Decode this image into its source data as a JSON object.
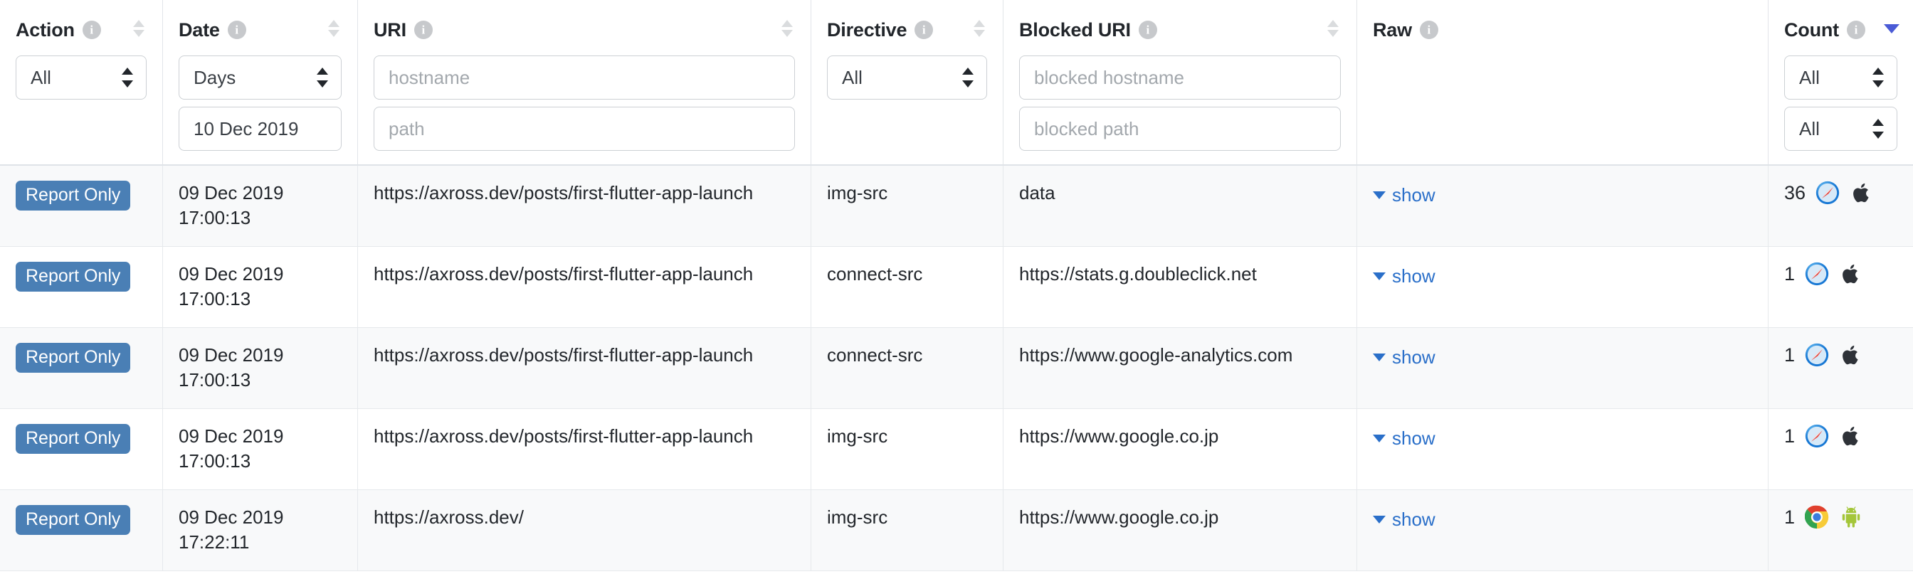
{
  "columns": [
    {
      "key": "action",
      "label": "Action",
      "sortable": true,
      "sort_state": "none"
    },
    {
      "key": "date",
      "label": "Date",
      "sortable": true,
      "sort_state": "none"
    },
    {
      "key": "uri",
      "label": "URI",
      "sortable": true,
      "sort_state": "none"
    },
    {
      "key": "dir",
      "label": "Directive",
      "sortable": true,
      "sort_state": "none"
    },
    {
      "key": "blocked",
      "label": "Blocked URI",
      "sortable": true,
      "sort_state": "none"
    },
    {
      "key": "raw",
      "label": "Raw",
      "sortable": false,
      "sort_state": "none"
    },
    {
      "key": "count",
      "label": "Count",
      "sortable": true,
      "sort_state": "desc"
    }
  ],
  "filters": {
    "action_select": "All",
    "date_select": "Days",
    "date_value": "10 Dec 2019",
    "uri_hostname_placeholder": "hostname",
    "uri_path_placeholder": "path",
    "directive_select": "All",
    "blocked_hostname_placeholder": "blocked hostname",
    "blocked_path_placeholder": "blocked path",
    "count_select_1": "All",
    "count_select_2": "All"
  },
  "icons": {
    "info": "info-icon",
    "sort": "sort-arrows-icon",
    "sort_desc": "sort-descending-icon",
    "stepper": "stepper-arrows-icon",
    "caret": "caret-down-icon"
  },
  "raw_link_label": "show",
  "rows": [
    {
      "action": "Report Only",
      "date_line1": "09 Dec 2019",
      "date_line2": "17:00:13",
      "uri": "https://axross.dev/posts/first-flutter-app-launch",
      "directive": "img-src",
      "blocked_uri": "data",
      "raw": "show",
      "count": "36",
      "browser": "safari",
      "os": "apple"
    },
    {
      "action": "Report Only",
      "date_line1": "09 Dec 2019",
      "date_line2": "17:00:13",
      "uri": "https://axross.dev/posts/first-flutter-app-launch",
      "directive": "connect-src",
      "blocked_uri": "https://stats.g.doubleclick.net",
      "raw": "show",
      "count": "1",
      "browser": "safari",
      "os": "apple"
    },
    {
      "action": "Report Only",
      "date_line1": "09 Dec 2019",
      "date_line2": "17:00:13",
      "uri": "https://axross.dev/posts/first-flutter-app-launch",
      "directive": "connect-src",
      "blocked_uri": "https://www.google-analytics.com",
      "raw": "show",
      "count": "1",
      "browser": "safari",
      "os": "apple"
    },
    {
      "action": "Report Only",
      "date_line1": "09 Dec 2019",
      "date_line2": "17:00:13",
      "uri": "https://axross.dev/posts/first-flutter-app-launch",
      "directive": "img-src",
      "blocked_uri": "https://www.google.co.jp",
      "raw": "show",
      "count": "1",
      "browser": "safari",
      "os": "apple"
    },
    {
      "action": "Report Only",
      "date_line1": "09 Dec 2019",
      "date_line2": "17:22:11",
      "uri": "https://axross.dev/",
      "directive": "img-src",
      "blocked_uri": "https://www.google.co.jp",
      "raw": "show",
      "count": "1",
      "browser": "chrome",
      "os": "android"
    }
  ],
  "colors": {
    "badge_bg": "#4a7fb5",
    "link": "#2a6fc9",
    "sort_active": "#4a5bd6",
    "row_odd_bg": "#f8f9fa",
    "border": "#e6e9ec"
  }
}
